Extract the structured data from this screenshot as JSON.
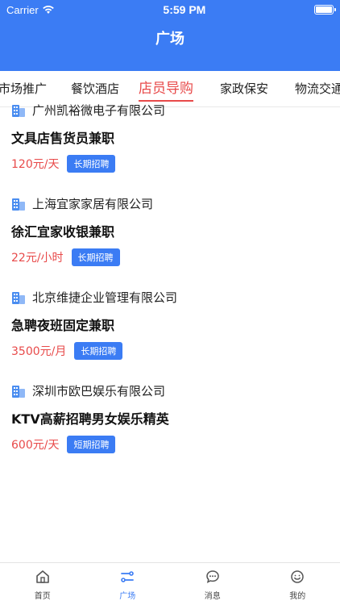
{
  "status": {
    "carrier": "Carrier",
    "time": "5:59 PM"
  },
  "nav": {
    "title": "广场"
  },
  "tabs": [
    "市场推广",
    "餐饮酒店",
    "店员导购",
    "家政保安",
    "物流交通"
  ],
  "jobs": [
    {
      "company": "广州凯裕微电子有限公司",
      "title": "文具店售货员兼职",
      "salary": "120元/天",
      "badge": "长期招聘"
    },
    {
      "company": "上海宜家家居有限公司",
      "title": "徐汇宜家收银兼职",
      "salary": "22元/小时",
      "badge": "长期招聘"
    },
    {
      "company": "北京维捷企业管理有限公司",
      "title": "急聘夜班固定兼职",
      "salary": "3500元/月",
      "badge": "长期招聘"
    },
    {
      "company": "深圳市欧巴娱乐有限公司",
      "title": "KTV高薪招聘男女娱乐精英",
      "salary": "600元/天",
      "badge": "短期招聘"
    }
  ],
  "tabbar": [
    "首页",
    "广场",
    "消息",
    "我的"
  ],
  "colors": {
    "primary": "#3b7cf4",
    "accent": "#e84a4a"
  }
}
